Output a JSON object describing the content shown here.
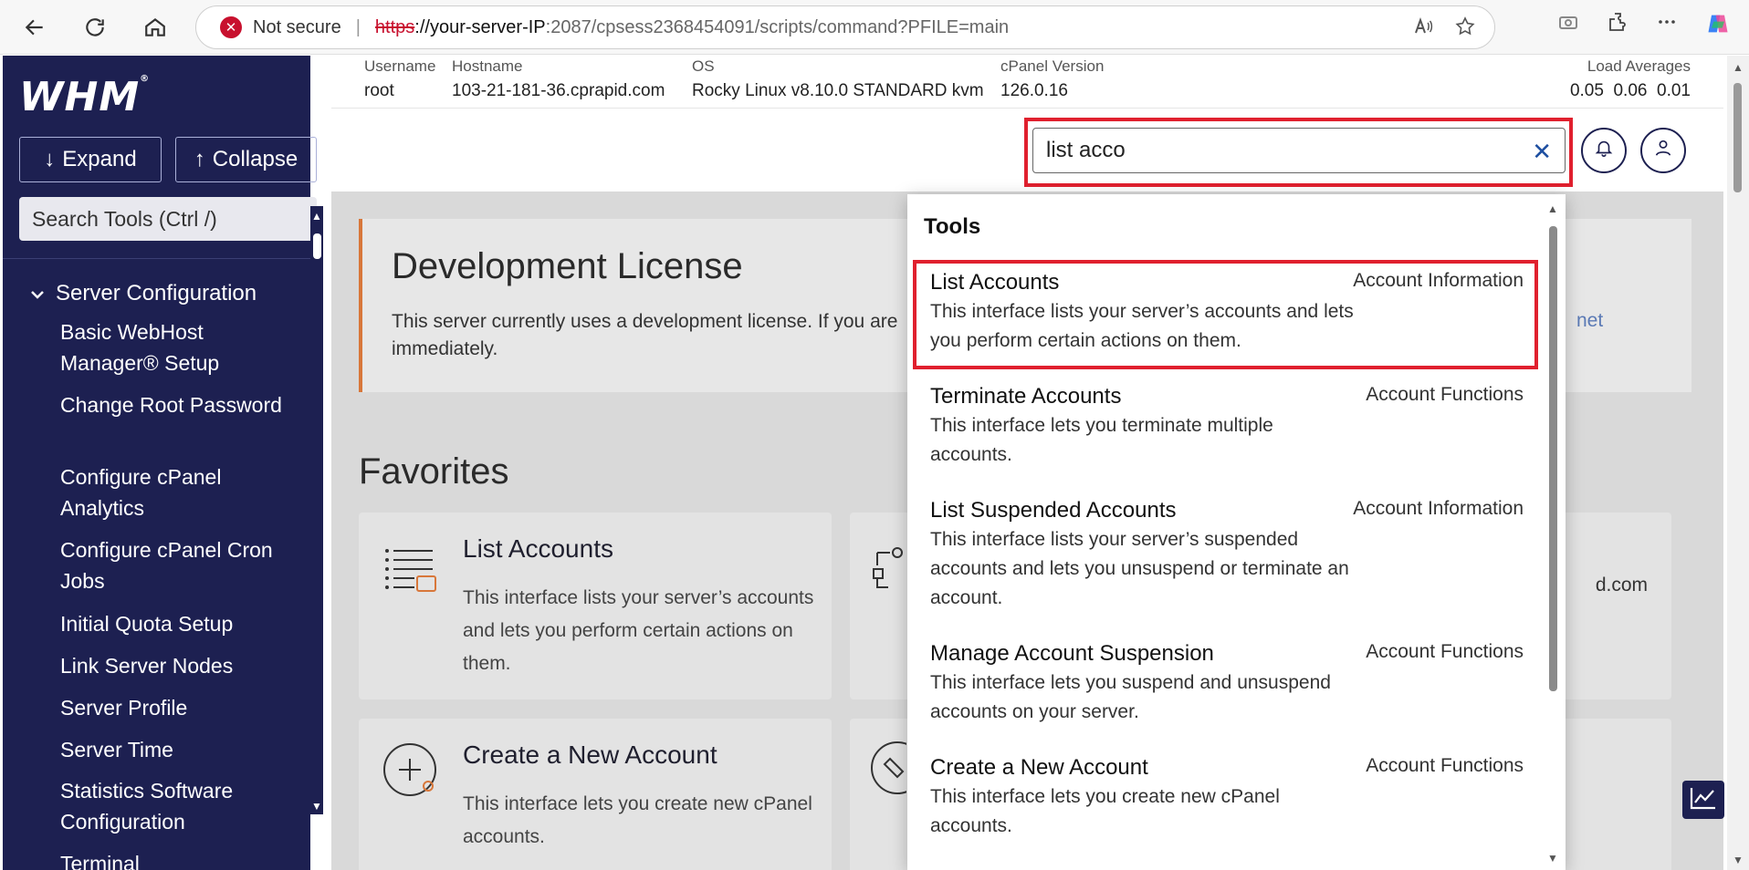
{
  "browser": {
    "not_secure": "Not secure",
    "url_scheme": "https",
    "url_host": "://your-server-IP",
    "url_path": " :2087/cpsess2368454091/scripts/command?PFILE=main"
  },
  "sidebar": {
    "logo": "WHM",
    "expand_label": "Expand",
    "collapse_label": "Collapse",
    "search_placeholder": "Search Tools (Ctrl /)",
    "category": "Server Configuration",
    "items": [
      "Basic WebHost Manager® Setup",
      "Change Root Password",
      "Configure cPanel Analytics",
      "Configure cPanel Cron Jobs",
      "Initial Quota Setup",
      "Link Server Nodes",
      "Server Profile",
      "Server Time",
      "Statistics Software Configuration",
      "Terminal"
    ]
  },
  "info": {
    "username_label": "Username",
    "username": "root",
    "hostname_label": "Hostname",
    "hostname": "103-21-181-36.cprapid.com",
    "os_label": "OS",
    "os": "Rocky Linux v8.10.0 STANDARD kvm",
    "cpanel_label": "cPanel Version",
    "cpanel": "126.0.16",
    "load_label": "Load Averages",
    "load": "0.05  0.06  0.01"
  },
  "search": {
    "value": "list acco"
  },
  "license": {
    "title": "Development License",
    "text": "This server currently uses a development license. If you are",
    "text2": "immediately.",
    "link": "net"
  },
  "favorites": {
    "title": "Favorites",
    "cards": [
      {
        "title": "List Accounts",
        "desc": "This interface lists your server’s accounts and lets you perform certain actions on them."
      },
      {
        "title": "Create a New Account",
        "desc": "This interface lets you create new cPanel accounts."
      }
    ],
    "partial_text": "d.com"
  },
  "dropdown": {
    "heading": "Tools",
    "items": [
      {
        "title": "List Accounts",
        "desc": "This interface lists your server’s accounts and lets you perform certain actions on them.",
        "category": "Account Information"
      },
      {
        "title": "Terminate Accounts",
        "desc": "This interface lets you terminate multiple accounts.",
        "category": "Account Functions"
      },
      {
        "title": "List Suspended Accounts",
        "desc": "This interface lists your server’s suspended accounts and lets you unsuspend or terminate an account.",
        "category": "Account Information"
      },
      {
        "title": "Manage Account Suspension",
        "desc": "This interface lets you suspend and unsuspend accounts on your server.",
        "category": "Account Functions"
      },
      {
        "title": "Create a New Account",
        "desc": "This interface lets you create new cPanel accounts.",
        "category": "Account Functions"
      }
    ]
  },
  "colors": {
    "sidebar_bg": "#1d2051",
    "highlight": "#e0202e",
    "license_accent": "#d8773a"
  }
}
